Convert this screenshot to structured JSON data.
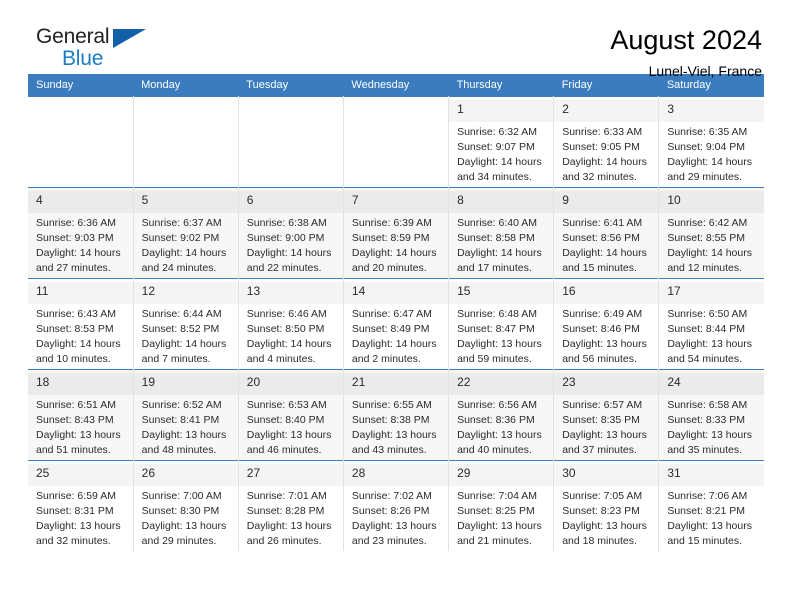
{
  "brand": {
    "name_part1": "General",
    "name_part2": "Blue",
    "triangle_color": "#1261a8",
    "blue_color": "#1a7dc4"
  },
  "header": {
    "title": "August 2024",
    "subtitle": "Lunel-Viel, France"
  },
  "theme": {
    "header_bg": "#3a7cbe",
    "header_text": "#ffffff",
    "row_shaded_bg": "#f7f7f7",
    "daynum_band_bg": "#f2f2f2",
    "grid_line": "#e2e2e2"
  },
  "weekday_headers": [
    "Sunday",
    "Monday",
    "Tuesday",
    "Wednesday",
    "Thursday",
    "Friday",
    "Saturday"
  ],
  "weeks": [
    [
      {
        "day": "",
        "detail": ""
      },
      {
        "day": "",
        "detail": ""
      },
      {
        "day": "",
        "detail": ""
      },
      {
        "day": "",
        "detail": ""
      },
      {
        "day": "1",
        "detail": "Sunrise: 6:32 AM\nSunset: 9:07 PM\nDaylight: 14 hours\nand 34 minutes."
      },
      {
        "day": "2",
        "detail": "Sunrise: 6:33 AM\nSunset: 9:05 PM\nDaylight: 14 hours\nand 32 minutes."
      },
      {
        "day": "3",
        "detail": "Sunrise: 6:35 AM\nSunset: 9:04 PM\nDaylight: 14 hours\nand 29 minutes."
      }
    ],
    [
      {
        "day": "4",
        "detail": "Sunrise: 6:36 AM\nSunset: 9:03 PM\nDaylight: 14 hours\nand 27 minutes."
      },
      {
        "day": "5",
        "detail": "Sunrise: 6:37 AM\nSunset: 9:02 PM\nDaylight: 14 hours\nand 24 minutes."
      },
      {
        "day": "6",
        "detail": "Sunrise: 6:38 AM\nSunset: 9:00 PM\nDaylight: 14 hours\nand 22 minutes."
      },
      {
        "day": "7",
        "detail": "Sunrise: 6:39 AM\nSunset: 8:59 PM\nDaylight: 14 hours\nand 20 minutes."
      },
      {
        "day": "8",
        "detail": "Sunrise: 6:40 AM\nSunset: 8:58 PM\nDaylight: 14 hours\nand 17 minutes."
      },
      {
        "day": "9",
        "detail": "Sunrise: 6:41 AM\nSunset: 8:56 PM\nDaylight: 14 hours\nand 15 minutes."
      },
      {
        "day": "10",
        "detail": "Sunrise: 6:42 AM\nSunset: 8:55 PM\nDaylight: 14 hours\nand 12 minutes."
      }
    ],
    [
      {
        "day": "11",
        "detail": "Sunrise: 6:43 AM\nSunset: 8:53 PM\nDaylight: 14 hours\nand 10 minutes."
      },
      {
        "day": "12",
        "detail": "Sunrise: 6:44 AM\nSunset: 8:52 PM\nDaylight: 14 hours\nand 7 minutes."
      },
      {
        "day": "13",
        "detail": "Sunrise: 6:46 AM\nSunset: 8:50 PM\nDaylight: 14 hours\nand 4 minutes."
      },
      {
        "day": "14",
        "detail": "Sunrise: 6:47 AM\nSunset: 8:49 PM\nDaylight: 14 hours\nand 2 minutes."
      },
      {
        "day": "15",
        "detail": "Sunrise: 6:48 AM\nSunset: 8:47 PM\nDaylight: 13 hours\nand 59 minutes."
      },
      {
        "day": "16",
        "detail": "Sunrise: 6:49 AM\nSunset: 8:46 PM\nDaylight: 13 hours\nand 56 minutes."
      },
      {
        "day": "17",
        "detail": "Sunrise: 6:50 AM\nSunset: 8:44 PM\nDaylight: 13 hours\nand 54 minutes."
      }
    ],
    [
      {
        "day": "18",
        "detail": "Sunrise: 6:51 AM\nSunset: 8:43 PM\nDaylight: 13 hours\nand 51 minutes."
      },
      {
        "day": "19",
        "detail": "Sunrise: 6:52 AM\nSunset: 8:41 PM\nDaylight: 13 hours\nand 48 minutes."
      },
      {
        "day": "20",
        "detail": "Sunrise: 6:53 AM\nSunset: 8:40 PM\nDaylight: 13 hours\nand 46 minutes."
      },
      {
        "day": "21",
        "detail": "Sunrise: 6:55 AM\nSunset: 8:38 PM\nDaylight: 13 hours\nand 43 minutes."
      },
      {
        "day": "22",
        "detail": "Sunrise: 6:56 AM\nSunset: 8:36 PM\nDaylight: 13 hours\nand 40 minutes."
      },
      {
        "day": "23",
        "detail": "Sunrise: 6:57 AM\nSunset: 8:35 PM\nDaylight: 13 hours\nand 37 minutes."
      },
      {
        "day": "24",
        "detail": "Sunrise: 6:58 AM\nSunset: 8:33 PM\nDaylight: 13 hours\nand 35 minutes."
      }
    ],
    [
      {
        "day": "25",
        "detail": "Sunrise: 6:59 AM\nSunset: 8:31 PM\nDaylight: 13 hours\nand 32 minutes."
      },
      {
        "day": "26",
        "detail": "Sunrise: 7:00 AM\nSunset: 8:30 PM\nDaylight: 13 hours\nand 29 minutes."
      },
      {
        "day": "27",
        "detail": "Sunrise: 7:01 AM\nSunset: 8:28 PM\nDaylight: 13 hours\nand 26 minutes."
      },
      {
        "day": "28",
        "detail": "Sunrise: 7:02 AM\nSunset: 8:26 PM\nDaylight: 13 hours\nand 23 minutes."
      },
      {
        "day": "29",
        "detail": "Sunrise: 7:04 AM\nSunset: 8:25 PM\nDaylight: 13 hours\nand 21 minutes."
      },
      {
        "day": "30",
        "detail": "Sunrise: 7:05 AM\nSunset: 8:23 PM\nDaylight: 13 hours\nand 18 minutes."
      },
      {
        "day": "31",
        "detail": "Sunrise: 7:06 AM\nSunset: 8:21 PM\nDaylight: 13 hours\nand 15 minutes."
      }
    ]
  ]
}
